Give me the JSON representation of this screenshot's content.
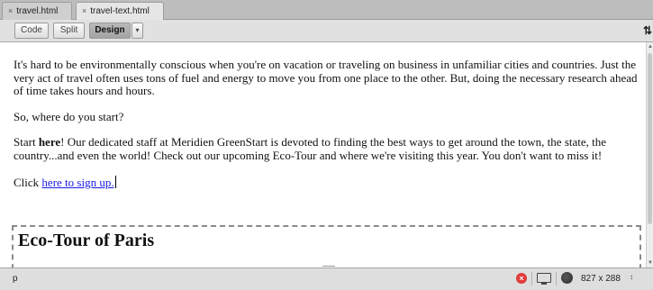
{
  "tabs": [
    {
      "close_glyph": "×",
      "label": "travel.html",
      "active": false
    },
    {
      "close_glyph": "×",
      "label": "travel-text.html",
      "active": true
    }
  ],
  "toolbar": {
    "code_label": "Code",
    "split_label": "Split",
    "design_label": "Design",
    "dropdown_glyph": "▾",
    "right_icon_glyph": "⇅"
  },
  "document": {
    "p1": "It's hard to be environmentally conscious when you're on vacation or traveling on business in unfamiliar cities and countries. Just the very act of travel often uses tons of fuel and energy to move you from one place to the other. But, doing the necessary research ahead of time takes hours and hours.",
    "p2": "So, where do you start?",
    "p3_start": "Start ",
    "p3_bold": "here",
    "p3_rest": "! Our dedicated staff at Meridien GreenStart is devoted to finding the best ways to get around the town, the state, the country...and even the world! Check out our upcoming Eco-Tour and where we're visiting this year. You don't want to miss it!",
    "p4_prefix": "Click ",
    "p4_link": "here to sign up.",
    "heading": "Eco-Tour of Paris"
  },
  "status": {
    "tag": "p",
    "error_glyph": "×",
    "window_size": "827 x 288",
    "size_arrows": "↕"
  },
  "icons": {
    "error": "error-icon",
    "monitor": "monitor-icon",
    "globe": "globe-icon"
  },
  "colors": {
    "link": "#1a1ae6",
    "error": "#e03b3b"
  }
}
